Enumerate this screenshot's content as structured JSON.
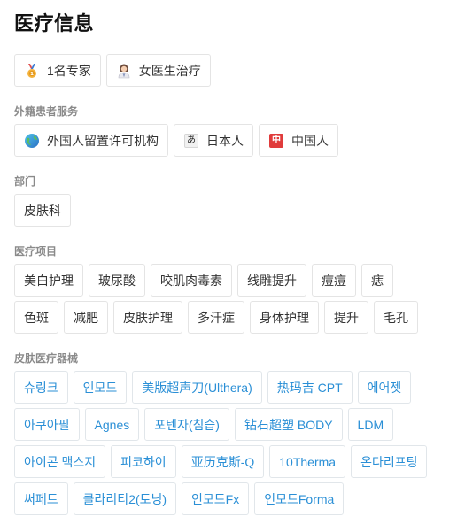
{
  "page_title": "医疗信息",
  "top_tags": [
    {
      "label": "1名专家",
      "icon": "medal-icon"
    },
    {
      "label": "女医生治疗",
      "icon": "female-doctor-icon"
    }
  ],
  "foreign_services": {
    "label": "外籍患者服务",
    "tags": [
      {
        "label": "外国人留置许可机构",
        "icon": "globe-icon"
      },
      {
        "label": "日本人",
        "icon": "japanese-char-icon"
      },
      {
        "label": "中国人",
        "icon": "chinese-char-icon"
      }
    ]
  },
  "department": {
    "label": "部门",
    "tags": [
      "皮肤科"
    ]
  },
  "treatments": {
    "label": "医疗项目",
    "rows": [
      [
        "美白护理",
        "玻尿酸",
        "咬肌肉毒素",
        "线雕提升",
        "痘痘",
        "痣"
      ],
      [
        "色斑",
        "减肥",
        "皮肤护理",
        "多汗症",
        "身体护理",
        "提升",
        "毛孔"
      ]
    ]
  },
  "devices": {
    "label": "皮肤医疗器械",
    "rows": [
      [
        "슈링크",
        "인모드",
        "美版超声刀(Ulthera)",
        "热玛吉 CPT",
        "에어젯"
      ],
      [
        "아쿠아필",
        "Agnes",
        "포텐자(침습)",
        "钻石超塑 BODY",
        "LDM"
      ],
      [
        "아이콘 맥스지",
        "피코하이",
        "亚历克斯-Q",
        "10Therma",
        "온다리프팅"
      ],
      [
        "써페트",
        "클라리티2(토닝)",
        "인모드Fx",
        "인모드Forma"
      ]
    ]
  },
  "colors": {
    "device_tag_text": "#2a8fd6",
    "section_label": "#8a8a8a",
    "tag_border": "#e4e4e4"
  }
}
